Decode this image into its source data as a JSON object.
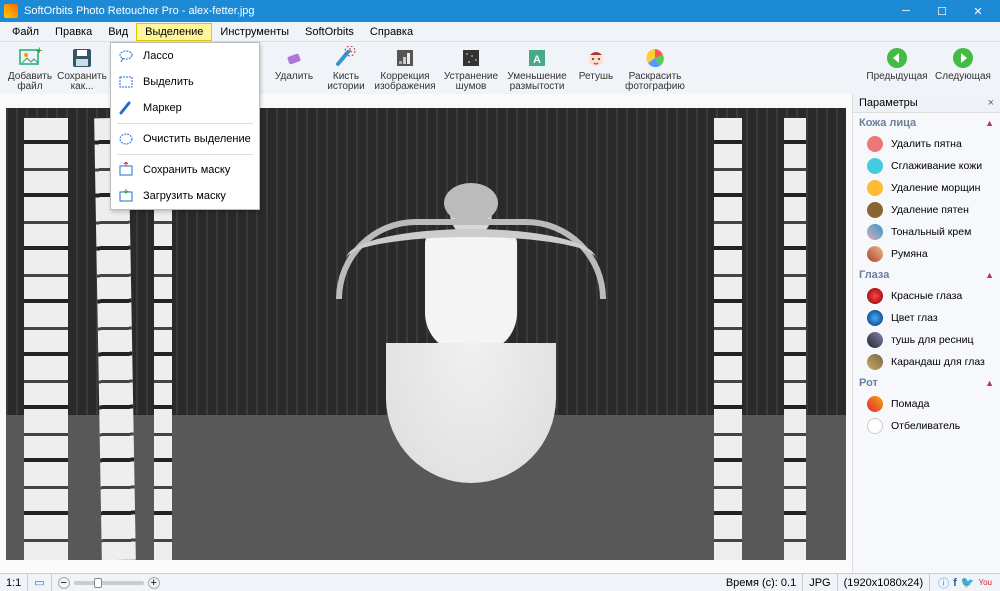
{
  "title": "SoftOrbits Photo Retoucher Pro - alex-fetter.jpg",
  "menubar": [
    "Файл",
    "Правка",
    "Вид",
    "Выделение",
    "Инструменты",
    "SoftOrbits",
    "Справка"
  ],
  "menubar_active_index": 3,
  "toolbar": {
    "add": "Добавить файл",
    "save": "Сохранить как...",
    "remove": "Удалить",
    "history": "Кисть истории",
    "correction": "Коррекция изображения",
    "noise": "Устранение шумов",
    "blur": "Уменьшение размытости",
    "retouch": "Ретушь",
    "colorize": "Раскрасить фотографию",
    "prev": "Предыдущая",
    "next": "Следующая"
  },
  "dropdown": {
    "lasso": "Лассо",
    "select": "Выделить",
    "marker": "Маркер",
    "clear": "Очистить выделение",
    "savemask": "Сохранить маску",
    "loadmask": "Загрузить маску"
  },
  "sidebar": {
    "title": "Параметры",
    "sections": {
      "face": {
        "title": "Кожа лица",
        "items": [
          "Удалить пятна",
          "Сглаживание кожи",
          "Удаление морщин",
          "Удаление пятен",
          "Тональный крем",
          "Румяна"
        ]
      },
      "eyes": {
        "title": "Глаза",
        "items": [
          "Красные глаза",
          "Цвет глаз",
          "тушь для ресниц",
          "Карандаш для глаз"
        ]
      },
      "mouth": {
        "title": "Рот",
        "items": [
          "Помада",
          "Отбеливатель"
        ]
      }
    }
  },
  "status": {
    "zoom": "1:1",
    "time_label": "Время (с): 0.1",
    "format": "JPG",
    "dims": "(1920x1080x24)"
  }
}
